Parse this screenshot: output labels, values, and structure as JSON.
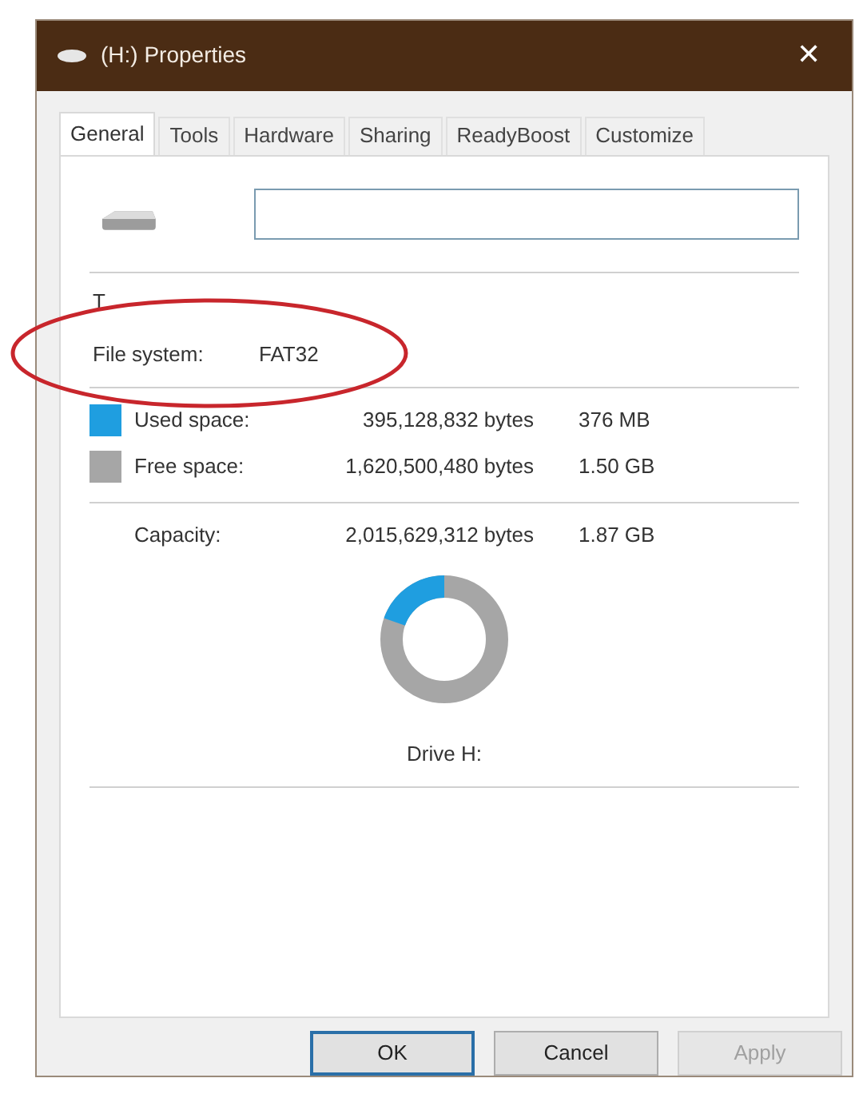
{
  "window": {
    "title": "(H:) Properties",
    "close": "✕"
  },
  "tabs": [
    {
      "label": "General",
      "selected": true
    },
    {
      "label": "Tools",
      "selected": false
    },
    {
      "label": "Hardware",
      "selected": false
    },
    {
      "label": "Sharing",
      "selected": false
    },
    {
      "label": "ReadyBoost",
      "selected": false
    },
    {
      "label": "Customize",
      "selected": false
    }
  ],
  "info": [
    {
      "label": "T"
    },
    {
      "label": "File system:",
      "value": "FAT32"
    }
  ],
  "highlight": {
    "kind": "ellipse"
  },
  "space": [
    {
      "label": "Used space:",
      "bytes": "395,128,832 bytes",
      "size": "376 MB",
      "color": "#1f9ee0"
    },
    {
      "label": "Free space:",
      "bytes": "1,620,500,480 bytes",
      "size": "1.50 GB",
      "color": "#a6a6a6"
    }
  ],
  "capacity": {
    "label": "Capacity:",
    "bytes": "2,015,629,312 bytes",
    "size": "1.87 GB"
  },
  "usage_chart": {
    "level": 0.196,
    "caption": "Drive H:"
  },
  "buttons": [
    {
      "label": "OK",
      "default": true,
      "disabled": false
    },
    {
      "label": "Cancel",
      "default": false,
      "disabled": false
    },
    {
      "label": "Apply",
      "default": false,
      "disabled": true
    }
  ]
}
